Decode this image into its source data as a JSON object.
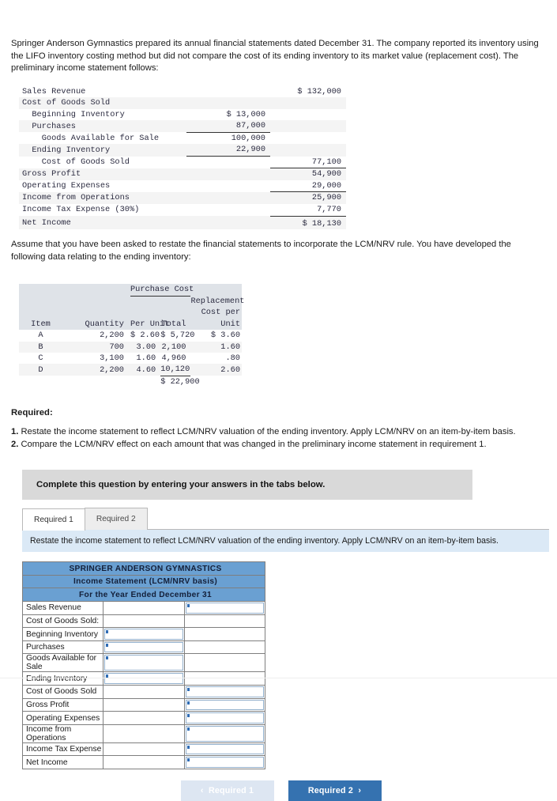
{
  "intro": {
    "paragraph1": "Springer Anderson Gymnastics prepared its annual financial statements dated December 31. The company reported its inventory using the LIFO inventory costing method but did not compare the cost of its ending inventory to its market value (replacement cost). The preliminary income statement follows:",
    "paragraph2": "Assume that you have been asked to restate the financial statements to incorporate the LCM/NRV rule. You have developed the following data relating to the ending inventory:"
  },
  "preliminary_statement": {
    "rows": [
      {
        "label": "Sales Revenue",
        "col1": "",
        "col2": "$ 132,000"
      },
      {
        "label": "Cost of Goods Sold",
        "col1": "",
        "col2": ""
      },
      {
        "label": "Beginning Inventory",
        "col1": "$ 13,000",
        "col2": ""
      },
      {
        "label": "Purchases",
        "col1": "87,000",
        "col2": ""
      },
      {
        "label": "Goods Available for Sale",
        "col1": "100,000",
        "col2": ""
      },
      {
        "label": "Ending Inventory",
        "col1": "22,900",
        "col2": ""
      },
      {
        "label": "Cost of Goods Sold",
        "col1": "",
        "col2": "77,100"
      },
      {
        "label": "Gross Profit",
        "col1": "",
        "col2": "54,900"
      },
      {
        "label": "Operating Expenses",
        "col1": "",
        "col2": "29,000"
      },
      {
        "label": "Income from Operations",
        "col1": "",
        "col2": "25,900"
      },
      {
        "label": "Income Tax Expense (30%)",
        "col1": "",
        "col2": "7,770"
      },
      {
        "label": "Net Income",
        "col1": "",
        "col2": "$ 18,130"
      }
    ]
  },
  "purchase_cost_table": {
    "group_header": "Purchase Cost",
    "headers": {
      "item": "Item",
      "quantity": "Quantity",
      "per_unit": "Per Unit",
      "total": "Total",
      "replacement_line1": "Replacement",
      "replacement_line2": "Cost per",
      "replacement_line3": "Unit"
    },
    "rows": [
      {
        "item": "A",
        "quantity": "2,200",
        "per_unit": "$ 2.60",
        "total": "$ 5,720",
        "replacement": "$ 3.60"
      },
      {
        "item": "B",
        "quantity": "700",
        "per_unit": "3.00",
        "total": "2,100",
        "replacement": "1.60"
      },
      {
        "item": "C",
        "quantity": "3,100",
        "per_unit": "1.60",
        "total": "4,960",
        "replacement": ".80"
      },
      {
        "item": "D",
        "quantity": "2,200",
        "per_unit": "4.60",
        "total": "10,120",
        "replacement": "2.60"
      }
    ],
    "total_row": "$ 22,900"
  },
  "required": {
    "heading": "Required:",
    "items": [
      {
        "num": "1.",
        "text": "Restate the income statement to reflect LCM/NRV valuation of the ending inventory. Apply LCM/NRV on an item-by-item basis."
      },
      {
        "num": "2.",
        "text": "Compare the LCM/NRV effect on each amount that was changed in the preliminary income statement in requirement 1."
      }
    ]
  },
  "banner": "Complete this question by entering your answers in the tabs below.",
  "tabs": [
    {
      "label": "Required 1",
      "active": true
    },
    {
      "label": "Required 2",
      "active": false
    }
  ],
  "tab_instruction": "Restate the income statement to reflect LCM/NRV valuation of the ending inventory. Apply LCM/NRV on an item-by-item basis.",
  "answer_table": {
    "title1": "SPRINGER ANDERSON GYMNASTICS",
    "title2": "Income Statement (LCM/NRV basis)",
    "title3": "For the Year Ended December 31",
    "rows": [
      {
        "label": "Sales Revenue",
        "indent": 0,
        "input": "right"
      },
      {
        "label": "Cost of Goods Sold:",
        "indent": 0,
        "input": "none"
      },
      {
        "label": "Beginning Inventory",
        "indent": 1,
        "input": "middle"
      },
      {
        "label": "Purchases",
        "indent": 1,
        "input": "middle"
      },
      {
        "label": "Goods Available for Sale",
        "indent": 2,
        "input": "middle"
      },
      {
        "label": "Ending Inventory",
        "indent": 1,
        "input": "middle"
      },
      {
        "label": "Cost of Goods Sold",
        "indent": 2,
        "input": "right"
      },
      {
        "label": "Gross Profit",
        "indent": 0,
        "input": "right"
      },
      {
        "label": "Operating Expenses",
        "indent": 0,
        "input": "right"
      },
      {
        "label": "Income from Operations",
        "indent": 0,
        "input": "right"
      },
      {
        "label": "Income Tax Expense",
        "indent": 0,
        "input": "right"
      },
      {
        "label": "Net Income",
        "indent": 0,
        "input": "right"
      }
    ]
  },
  "nav": {
    "prev_label": "Required 1",
    "next_label": "Required 2",
    "prev_chevron": "‹",
    "next_chevron": "›"
  },
  "colors": {
    "header_blue": "#6aa0d2",
    "band_blue": "#dbe9f6",
    "button_blue": "#3572b0",
    "banner_grey": "#d9d9d9"
  }
}
